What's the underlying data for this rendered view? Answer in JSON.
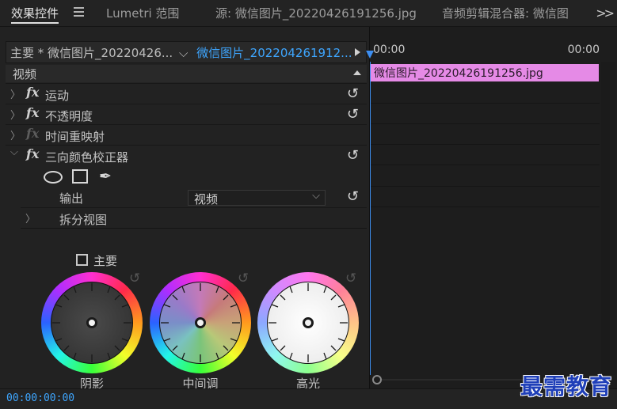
{
  "tabs": {
    "effect_controls": "效果控件",
    "lumetri_scopes": "Lumetri 范围",
    "source": "源: 微信图片_20220426191256.jpg",
    "audio_mixer": "音频剪辑混合器: 微信图",
    "more": ">>"
  },
  "clip_bar": {
    "master": "主要 * 微信图片_20220426...",
    "sequence": "微信图片_202204261912..."
  },
  "section": {
    "video": "视频"
  },
  "effects": [
    {
      "label": "运动",
      "fx": "fx"
    },
    {
      "label": "不透明度",
      "fx": "fx"
    },
    {
      "label": "时间重映射",
      "fx": "fx"
    },
    {
      "label": "三向颜色校正器",
      "fx": "fx"
    }
  ],
  "three_way": {
    "output_label": "输出",
    "output_value": "视频",
    "split_view_label": "拆分视图",
    "master_label": "主要",
    "wheels": [
      {
        "label": "阴影"
      },
      {
        "label": "中间调"
      },
      {
        "label": "高光"
      }
    ]
  },
  "timeline": {
    "start_time": "00:00",
    "end_time": "00:00",
    "clip_name": "微信图片_20220426191256.jpg"
  },
  "footer": {
    "timecode": "00:00:00:00"
  },
  "watermark": "最需教育",
  "colors": {
    "accent_blue": "#3ea6ff",
    "clip_pink": "#e58ae6",
    "panel_bg": "#222222",
    "watermark_blue": "#1f3fb8"
  }
}
